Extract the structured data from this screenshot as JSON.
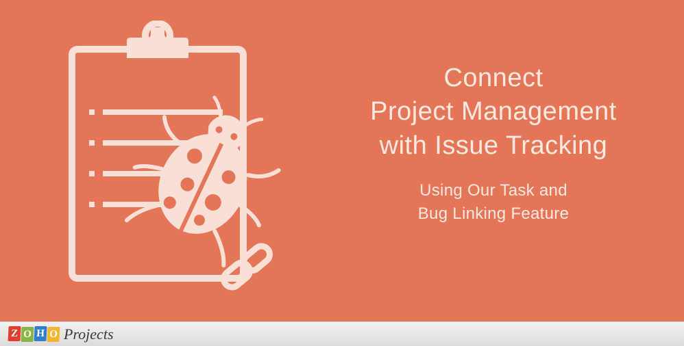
{
  "banner": {
    "heading_line1": "Connect",
    "heading_line2": "Project Management",
    "heading_line3": "with Issue Tracking",
    "subheading_line1": "Using Our Task and",
    "subheading_line2": "Bug Linking Feature",
    "background_color": "#E47657",
    "text_color": "#FDE8E0"
  },
  "footer": {
    "logo_letters": [
      "Z",
      "O",
      "H",
      "O"
    ],
    "product_name": "Projects"
  },
  "illustration": {
    "clipboard_icon": "clipboard",
    "bug_icon": "ladybug",
    "link_icon": "chain-link"
  }
}
